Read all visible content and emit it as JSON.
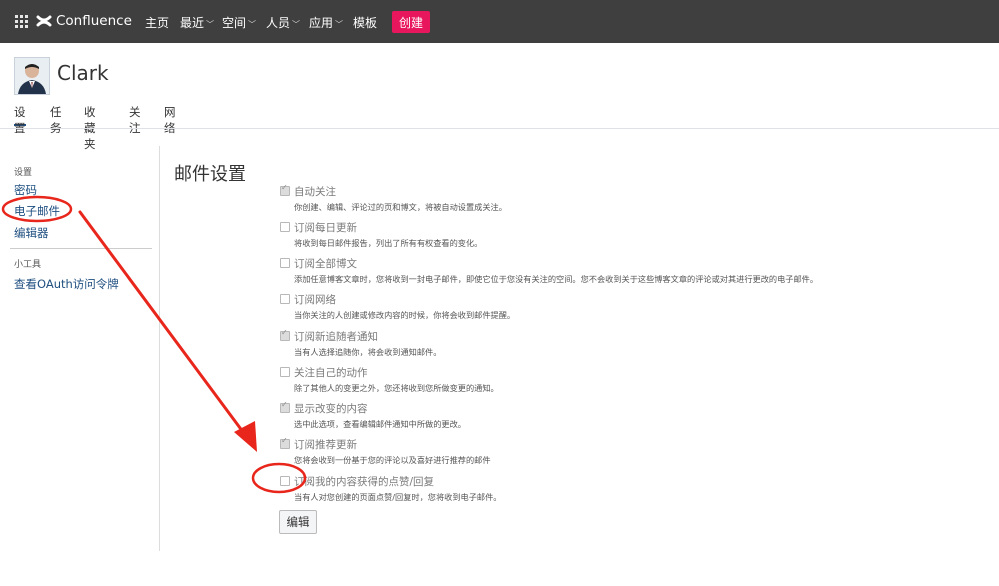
{
  "header": {
    "app_name": "Confluence",
    "nav": [
      {
        "label": "主页",
        "dropdown": false
      },
      {
        "label": "最近",
        "dropdown": true
      },
      {
        "label": "空间",
        "dropdown": true
      },
      {
        "label": "人员",
        "dropdown": true
      },
      {
        "label": "应用",
        "dropdown": true
      },
      {
        "label": "模板",
        "dropdown": false
      }
    ],
    "create_label": "创建",
    "create_color": "#e8175d",
    "bar_color": "#3f3f3f"
  },
  "profile": {
    "name": "Clark",
    "tabs": [
      "设置",
      "任务",
      "收藏夹",
      "关注",
      "网络"
    ],
    "active_tab": "设置"
  },
  "sidebar": {
    "settings_heading": "设置",
    "settings_items": [
      "密码",
      "电子邮件",
      "编辑器"
    ],
    "tools_heading": "小工具",
    "tools_items": [
      "查看OAuth访问令牌"
    ],
    "link_color": "#205081"
  },
  "main": {
    "title": "邮件设置",
    "options": [
      {
        "label": "自动关注",
        "checked": true,
        "description": "你创建、编辑、评论过的页和博文，将被自动设置成关注。"
      },
      {
        "label": "订阅每日更新",
        "checked": false,
        "description": "将收到每日邮件报告，列出了所有有权查看的变化。"
      },
      {
        "label": "订阅全部博文",
        "checked": false,
        "description": "添加任意博客文章时，您将收到一封电子邮件，即使它位于您没有关注的空间。您不会收到关于这些博客文章的评论或对其进行更改的电子邮件。"
      },
      {
        "label": "订阅网络",
        "checked": false,
        "description": "当你关注的人创建或修改内容的时候，你将会收到邮件提醒。"
      },
      {
        "label": "订阅新追随者通知",
        "checked": true,
        "description": "当有人选择追随你，将会收到通知邮件。"
      },
      {
        "label": "关注自己的动作",
        "checked": false,
        "description": "除了其他人的变更之外，您还将收到您所做变更的通知。"
      },
      {
        "label": "显示改变的内容",
        "checked": true,
        "description": "选中此选项，查看编辑邮件通知中所做的更改。"
      },
      {
        "label": "订阅推荐更新",
        "checked": true,
        "description": "您将会收到一份基于您的评论以及喜好进行推荐的邮件"
      },
      {
        "label": "订阅我的内容获得的点赞/回复",
        "checked": false,
        "description": "当有人对您创建的页面点赞/回复时，您将收到电子邮件。"
      }
    ],
    "edit_label": "编辑"
  },
  "annotation_color": "#e8261c"
}
